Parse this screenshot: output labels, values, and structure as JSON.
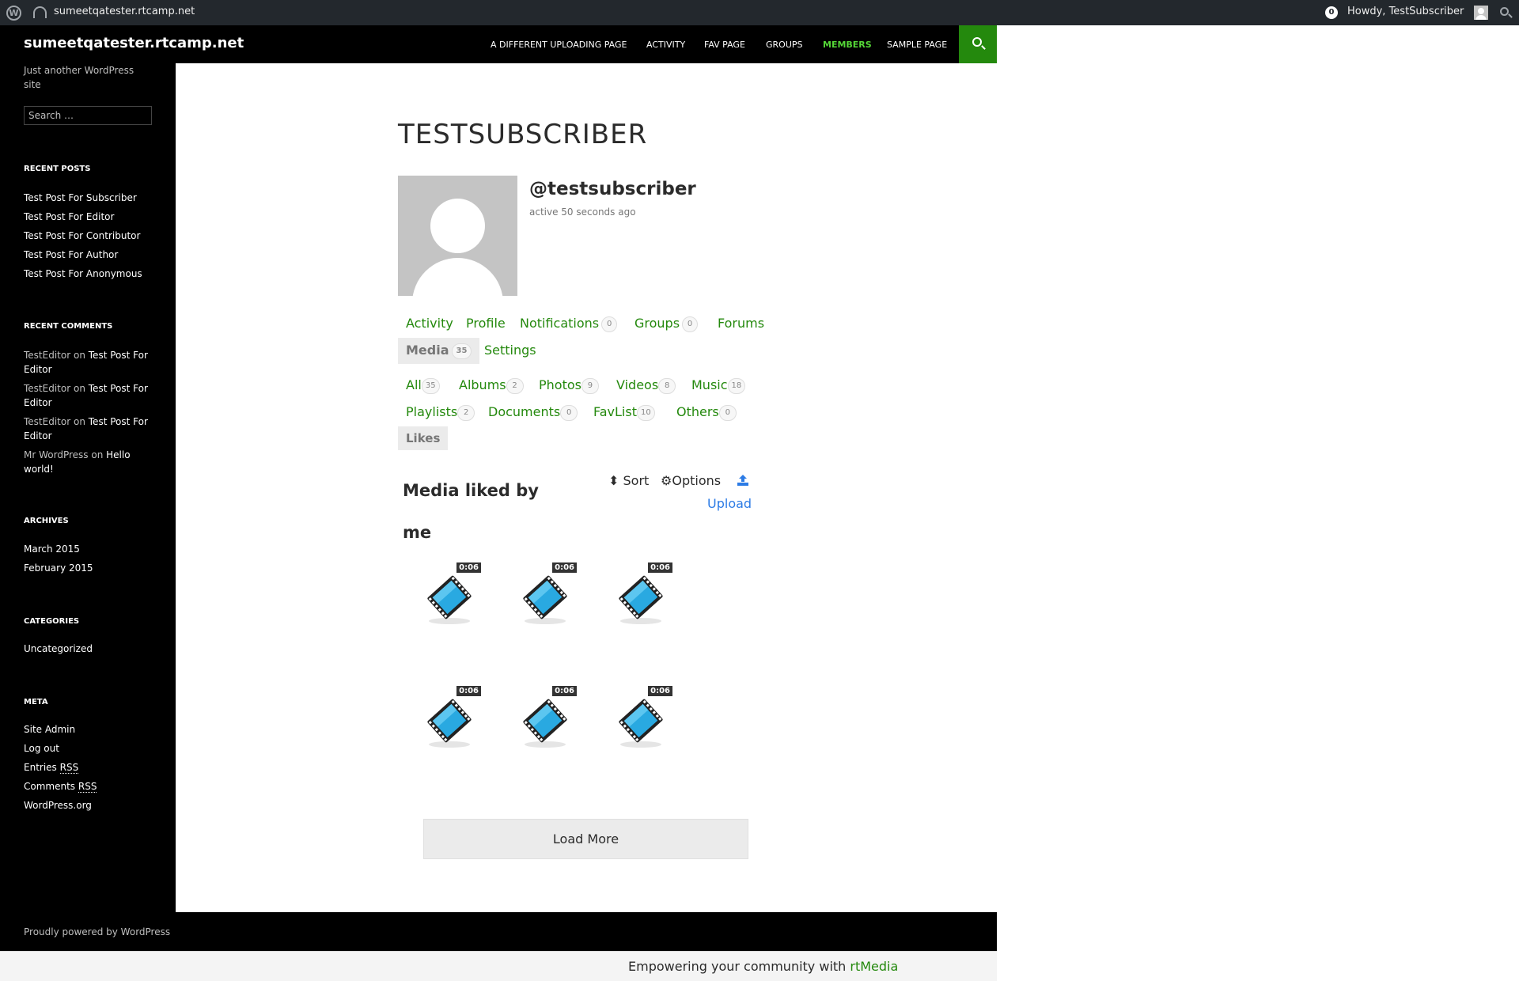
{
  "adminbar": {
    "site_name": "sumeetqatester.rtcamp.net",
    "notification_count": "0",
    "howdy": "Howdy, TestSubscriber"
  },
  "header": {
    "site_title": "sumeetqatester.rtcamp.net",
    "nav": [
      "A DIFFERENT UPLOADING PAGE",
      "ACTIVITY",
      "FAV PAGE",
      "GROUPS",
      "MEMBERS",
      "SAMPLE PAGE"
    ],
    "active_nav": "MEMBERS"
  },
  "sidebar": {
    "tagline": "Just another WordPress site",
    "search_placeholder": "Search …",
    "recent_posts_title": "RECENT POSTS",
    "recent_posts": [
      "Test Post For Subscriber",
      "Test Post For Editor",
      "Test Post For Contributor",
      "Test Post For Author",
      "Test Post For Anonymous"
    ],
    "recent_comments_title": "RECENT COMMENTS",
    "recent_comments": [
      {
        "author": "TestEditor",
        "on": "on",
        "post": "Test Post For Editor"
      },
      {
        "author": "TestEditor",
        "on": "on",
        "post": "Test Post For Editor"
      },
      {
        "author": "TestEditor",
        "on": "on",
        "post": "Test Post For Editor"
      },
      {
        "author": "Mr WordPress",
        "on": "on",
        "post": "Hello world!"
      }
    ],
    "archives_title": "ARCHIVES",
    "archives": [
      "March 2015",
      "February 2015"
    ],
    "categories_title": "CATEGORIES",
    "categories": [
      "Uncategorized"
    ],
    "meta_title": "META",
    "meta": {
      "site_admin": "Site Admin",
      "log_out": "Log out",
      "entries": "Entries",
      "comments": "Comments",
      "rss": "RSS",
      "wordpress_org": "WordPress.org"
    }
  },
  "profile": {
    "title": "TESTSUBSCRIBER",
    "username": "@testsubscriber",
    "last_active": "active 50 seconds ago",
    "tabs": [
      {
        "label": "Activity"
      },
      {
        "label": "Profile"
      },
      {
        "label": "Notifications",
        "count": "0"
      },
      {
        "label": "Groups",
        "count": "0"
      },
      {
        "label": "Forums"
      },
      {
        "label": "Media",
        "count": "35"
      },
      {
        "label": "Settings"
      }
    ],
    "media_tabs": [
      {
        "label": "All",
        "count": "35"
      },
      {
        "label": "Albums",
        "count": "2"
      },
      {
        "label": "Photos",
        "count": "9"
      },
      {
        "label": "Videos",
        "count": "8"
      },
      {
        "label": "Music",
        "count": "18"
      },
      {
        "label": "Playlists",
        "count": "2"
      },
      {
        "label": "Documents",
        "count": "0"
      },
      {
        "label": "FavList",
        "count": "10"
      },
      {
        "label": "Others",
        "count": "0"
      },
      {
        "label": "Likes"
      }
    ]
  },
  "gallery": {
    "title": "Media liked by me",
    "sort": "Sort",
    "options": "Options",
    "upload": "Upload",
    "items": [
      {
        "duration": "0:06",
        "icon": "video-film-icon"
      },
      {
        "duration": "0:06",
        "icon": "video-film-icon"
      },
      {
        "duration": "0:06",
        "icon": "video-film-icon"
      },
      {
        "duration": "0:06",
        "icon": "video-film-icon"
      },
      {
        "duration": "0:06",
        "icon": "video-film-icon"
      },
      {
        "duration": "0:06",
        "icon": "video-film-icon"
      }
    ],
    "load_more": "Load More"
  },
  "footer": {
    "credit": "Proudly powered by WordPress",
    "rtmedia_text": "Empowering your community with",
    "rtmedia_link": "rtMedia"
  },
  "colors": {
    "accent": "#24890d",
    "active_nav": "#55d737",
    "link_blue": "#2c7be5"
  }
}
